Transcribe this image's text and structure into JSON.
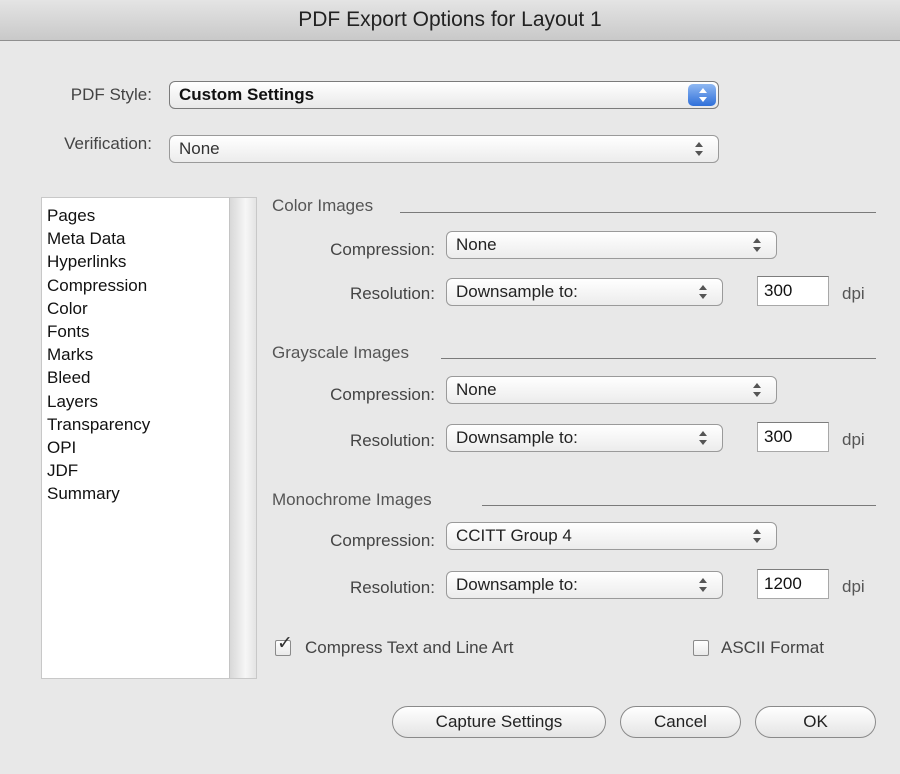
{
  "window": {
    "title": "PDF Export Options for Layout 1"
  },
  "header": {
    "pdf_style_label": "PDF Style:",
    "pdf_style_value": "Custom Settings",
    "verification_label": "Verification:",
    "verification_value": "None"
  },
  "sidebar": {
    "items": [
      {
        "label": "Pages"
      },
      {
        "label": "Meta Data"
      },
      {
        "label": "Hyperlinks"
      },
      {
        "label": "Compression"
      },
      {
        "label": "Color"
      },
      {
        "label": "Fonts"
      },
      {
        "label": "Marks"
      },
      {
        "label": "Bleed"
      },
      {
        "label": "Layers"
      },
      {
        "label": "Transparency"
      },
      {
        "label": "OPI"
      },
      {
        "label": "JDF"
      },
      {
        "label": "Summary"
      }
    ]
  },
  "compression": {
    "compression_label": "Compression:",
    "resolution_label": "Resolution:",
    "dpi_unit": "dpi",
    "color": {
      "title": "Color Images",
      "compression": "None",
      "resolution_mode": "Downsample to:",
      "resolution_value": "300"
    },
    "grayscale": {
      "title": "Grayscale Images",
      "compression": "None",
      "resolution_mode": "Downsample to:",
      "resolution_value": "300"
    },
    "monochrome": {
      "title": "Monochrome Images",
      "compression": "CCITT Group 4",
      "resolution_mode": "Downsample to:",
      "resolution_value": "1200"
    },
    "compress_text_label": "Compress Text and Line Art",
    "compress_text_checked": true,
    "ascii_label": "ASCII Format",
    "ascii_checked": false
  },
  "buttons": {
    "capture": "Capture Settings",
    "cancel": "Cancel",
    "ok": "OK"
  }
}
